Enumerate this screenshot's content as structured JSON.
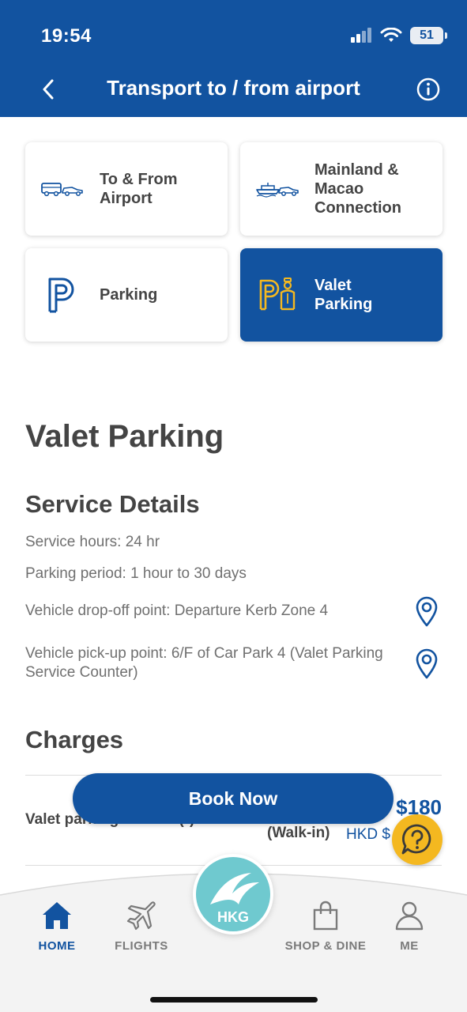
{
  "status_bar": {
    "time": "19:54",
    "battery": "51"
  },
  "header": {
    "title": "Transport to / from airport"
  },
  "tiles": [
    {
      "label": "To & From\nAirport",
      "icon": "bus-car-icon",
      "active": false
    },
    {
      "label": "Mainland &\nMacao\nConnection",
      "icon": "ferry-car-icon",
      "active": false
    },
    {
      "label": "Parking",
      "icon": "parking-icon",
      "active": false
    },
    {
      "label": "Valet\nParking",
      "icon": "valet-parking-icon",
      "active": true
    }
  ],
  "page": {
    "heading": "Valet Parking"
  },
  "service": {
    "heading": "Service Details",
    "hours": "Service hours: 24 hr",
    "period": "Parking period: 1 hour to 30 days",
    "dropoff": "Vehicle drop-off point: Departure Kerb Zone 4",
    "pickup": "Vehicle pick-up point: 6/F of Car Park 4 (Valet Parking Service Counter)"
  },
  "charges": {
    "heading": "Charges",
    "row_label": "Valet parking service (*)",
    "price": "$180",
    "walkin": "(Walk-in)",
    "currency": "HKD $"
  },
  "cta": {
    "book_label": "Book Now"
  },
  "tabbar": {
    "home": "HOME",
    "flights": "FLIGHTS",
    "logo": "HKG",
    "shop": "SHOP & DINE",
    "me": "ME"
  },
  "colors": {
    "primary": "#1253a0",
    "accent": "#f4b820",
    "logo": "#6fc9cf"
  }
}
